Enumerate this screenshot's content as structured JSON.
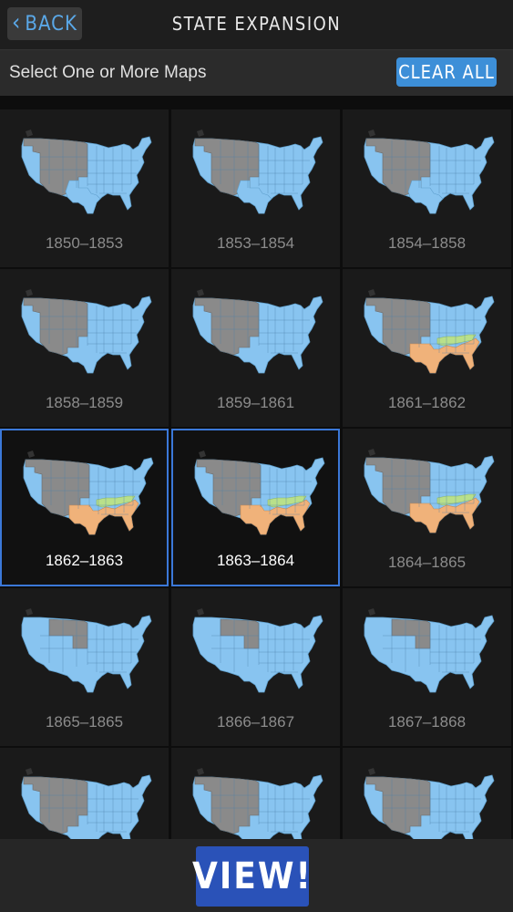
{
  "header": {
    "back_label": "BACK",
    "title": "STATE EXPANSION"
  },
  "subheader": {
    "prompt": "Select One or More Maps",
    "clear_label": "CLEAR ALL"
  },
  "colors": {
    "union": "#88c4f0",
    "territory": "#8a8a8a",
    "confederate": "#f0b27a",
    "border": "#b8e0f8",
    "selected_border": "#3b78d8",
    "accent": "#3d8fd8"
  },
  "maps": [
    {
      "label": "1850–1853",
      "selected": false
    },
    {
      "label": "1853–1854",
      "selected": false
    },
    {
      "label": "1854–1858",
      "selected": false
    },
    {
      "label": "1858–1859",
      "selected": false
    },
    {
      "label": "1859–1861",
      "selected": false
    },
    {
      "label": "1861–1862",
      "selected": false
    },
    {
      "label": "1862–1863",
      "selected": true
    },
    {
      "label": "1863–1864",
      "selected": true
    },
    {
      "label": "1864–1865",
      "selected": false
    },
    {
      "label": "1865–1865",
      "selected": false
    },
    {
      "label": "1866–1867",
      "selected": false
    },
    {
      "label": "1867–1868",
      "selected": false
    },
    {
      "label": "",
      "selected": false
    },
    {
      "label": "",
      "selected": false
    },
    {
      "label": "",
      "selected": false
    }
  ],
  "footer": {
    "view_label": "VIEW!"
  }
}
